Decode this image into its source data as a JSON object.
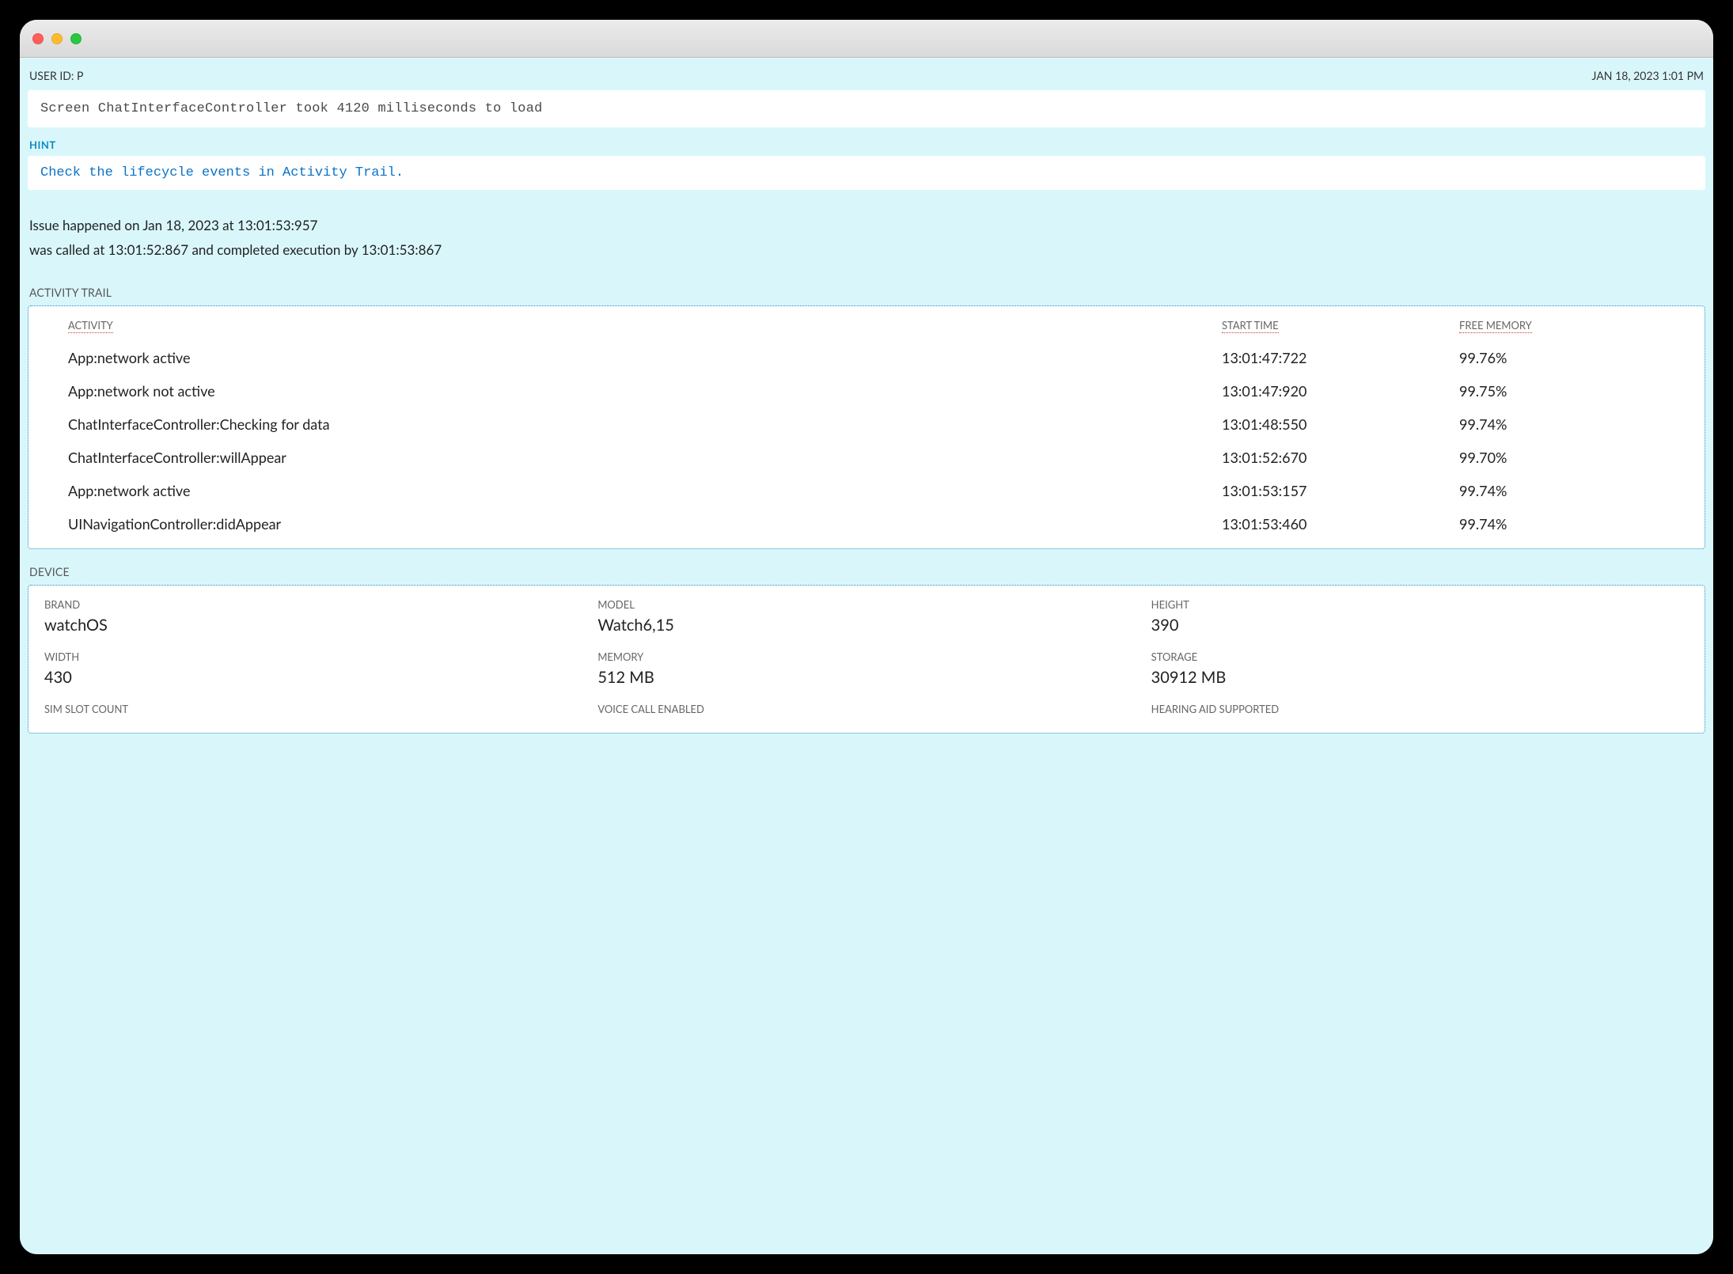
{
  "topbar": {
    "user_id_label": "USER ID: P",
    "timestamp": "JAN 18, 2023 1:01 PM"
  },
  "message": "Screen ChatInterfaceController took 4120 milliseconds to load",
  "hint_label": "HINT",
  "hint_text": "Check the lifecycle events in Activity Trail.",
  "timing": {
    "line1": "Issue happened on Jan 18, 2023 at 13:01:53:957",
    "line2": "was called at 13:01:52:867 and completed execution by 13:01:53:867"
  },
  "activity_trail": {
    "label": "ACTIVITY TRAIL",
    "headers": {
      "activity": "ACTIVITY",
      "start_time": "START TIME",
      "free_memory": "FREE MEMORY"
    },
    "rows": [
      {
        "activity": "App:network active",
        "start_time": "13:01:47:722",
        "free_memory": "99.76%"
      },
      {
        "activity": "App:network not active",
        "start_time": "13:01:47:920",
        "free_memory": "99.75%"
      },
      {
        "activity": "ChatInterfaceController:Checking for data",
        "start_time": "13:01:48:550",
        "free_memory": "99.74%"
      },
      {
        "activity": "ChatInterfaceController:willAppear",
        "start_time": "13:01:52:670",
        "free_memory": "99.70%"
      },
      {
        "activity": "App:network active",
        "start_time": "13:01:53:157",
        "free_memory": "99.74%"
      },
      {
        "activity": "UINavigationController:didAppear",
        "start_time": "13:01:53:460",
        "free_memory": "99.74%"
      }
    ]
  },
  "device": {
    "label": "DEVICE",
    "cells": [
      {
        "label": "BRAND",
        "value": "watchOS"
      },
      {
        "label": "MODEL",
        "value": "Watch6,15"
      },
      {
        "label": "HEIGHT",
        "value": "390"
      },
      {
        "label": "WIDTH",
        "value": "430"
      },
      {
        "label": "MEMORY",
        "value": "512 MB"
      },
      {
        "label": "STORAGE",
        "value": "30912 MB"
      },
      {
        "label": "SIM SLOT COUNT",
        "value": ""
      },
      {
        "label": "VOICE CALL ENABLED",
        "value": ""
      },
      {
        "label": "HEARING AID SUPPORTED",
        "value": ""
      }
    ]
  }
}
